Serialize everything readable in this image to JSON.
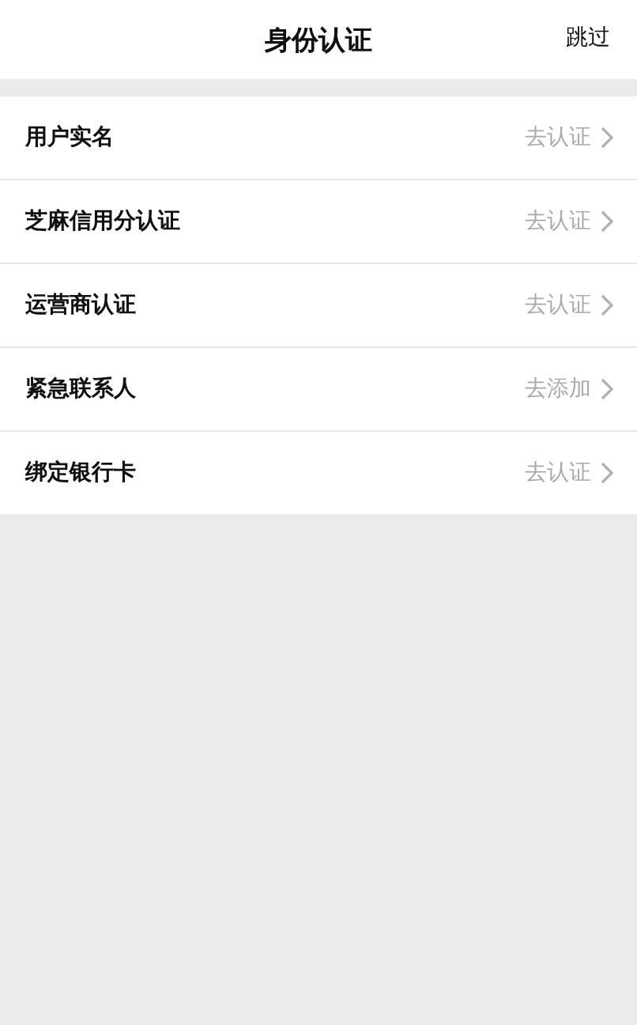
{
  "header": {
    "title": "身份认证",
    "skip": "跳过"
  },
  "items": [
    {
      "label": "用户实名",
      "action": "去认证"
    },
    {
      "label": "芝麻信用分认证",
      "action": "去认证"
    },
    {
      "label": "运营商认证",
      "action": "去认证"
    },
    {
      "label": "紧急联系人",
      "action": "去添加"
    },
    {
      "label": "绑定银行卡",
      "action": "去认证"
    }
  ]
}
